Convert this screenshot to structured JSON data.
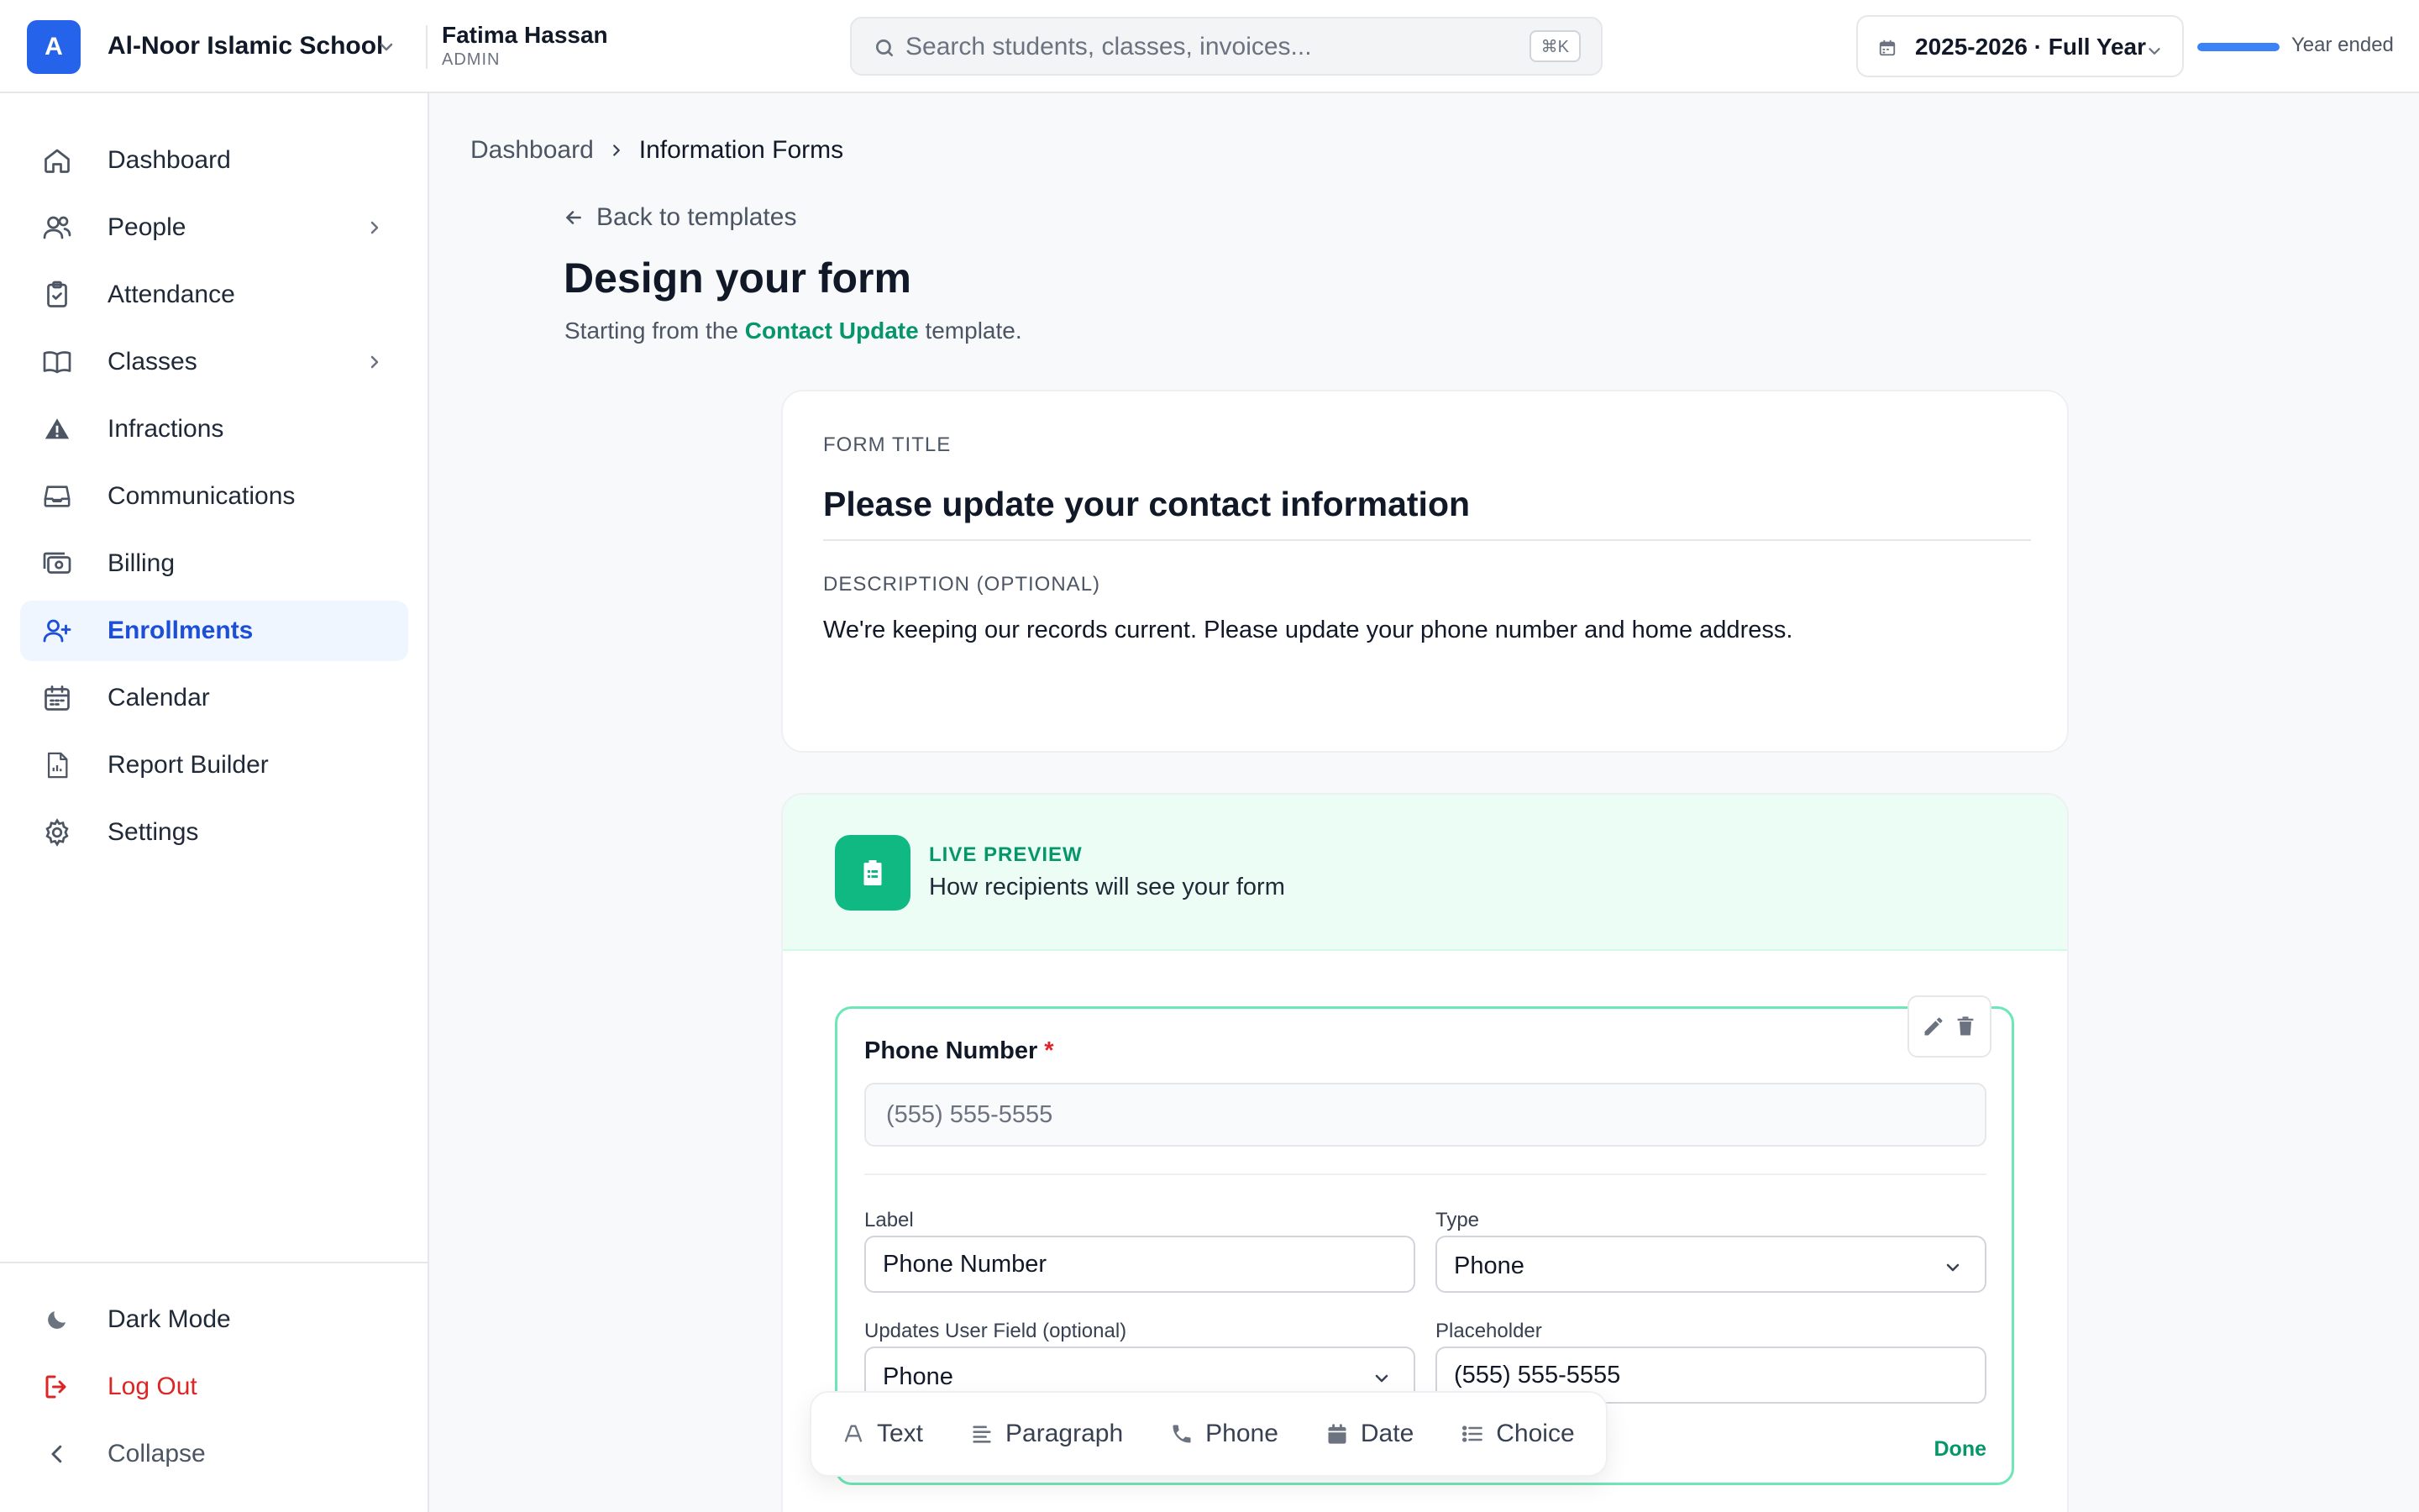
{
  "header": {
    "school_initial": "A",
    "school_name": "Al-Noor Islamic School",
    "user_name": "Fatima Hassan",
    "user_role": "ADMIN",
    "search_placeholder": "Search students, classes, invoices...",
    "search_shortcut": "⌘K",
    "year_label": "2025-2026 · Full Year",
    "year_progress_pct": 100,
    "year_status": "Year ended"
  },
  "sidebar": {
    "items": [
      {
        "label": "Dashboard",
        "icon": "home-icon"
      },
      {
        "label": "People",
        "icon": "users-icon"
      },
      {
        "label": "Attendance",
        "icon": "clipboard-check-icon"
      },
      {
        "label": "Classes",
        "icon": "book-icon"
      },
      {
        "label": "Infractions",
        "icon": "warning-icon"
      },
      {
        "label": "Communications",
        "icon": "inbox-icon"
      },
      {
        "label": "Billing",
        "icon": "cash-icon"
      },
      {
        "label": "Enrollments",
        "icon": "user-plus-icon",
        "active": true
      },
      {
        "label": "Calendar",
        "icon": "calendar-icon"
      },
      {
        "label": "Report Builder",
        "icon": "report-icon"
      },
      {
        "label": "Settings",
        "icon": "gear-icon"
      }
    ],
    "footer": {
      "dark_mode": "Dark Mode",
      "logout": "Log Out",
      "collapse": "Collapse"
    }
  },
  "breadcrumb": {
    "root": "Dashboard",
    "current": "Information Forms"
  },
  "back_link": "Back to templates",
  "page": {
    "title": "Design your form",
    "subtitle_prefix": "Starting from the ",
    "subtitle_template": "Contact Update",
    "subtitle_suffix": " template."
  },
  "form": {
    "title_caption": "FORM TITLE",
    "title_value": "Please update your contact information",
    "desc_caption": "DESCRIPTION (OPTIONAL)",
    "desc_value": "We're keeping our records current. Please update your phone number and home address."
  },
  "preview": {
    "tag": "LIVE PREVIEW",
    "subtitle": "How recipients will see your form"
  },
  "field": {
    "label": "Phone Number",
    "required_mark": "*",
    "placeholder": "(555) 555-5555",
    "editor": {
      "label_caption": "Label",
      "label_value": "Phone Number",
      "type_caption": "Type",
      "type_value": "Phone",
      "user_field_caption": "Updates User Field (optional)",
      "user_field_value": "Phone",
      "placeholder_caption": "Placeholder",
      "placeholder_value": "(555) 555-5555",
      "done": "Done"
    }
  },
  "toolbar": {
    "items": [
      {
        "label": "Text",
        "icon": "text-icon"
      },
      {
        "label": "Paragraph",
        "icon": "paragraph-icon"
      },
      {
        "label": "Phone",
        "icon": "phone-icon"
      },
      {
        "label": "Date",
        "icon": "calendar-icon"
      },
      {
        "label": "Choice",
        "icon": "list-icon"
      }
    ]
  },
  "colors": {
    "accent": "#2563eb",
    "success": "#059669",
    "danger": "#dc2626"
  }
}
